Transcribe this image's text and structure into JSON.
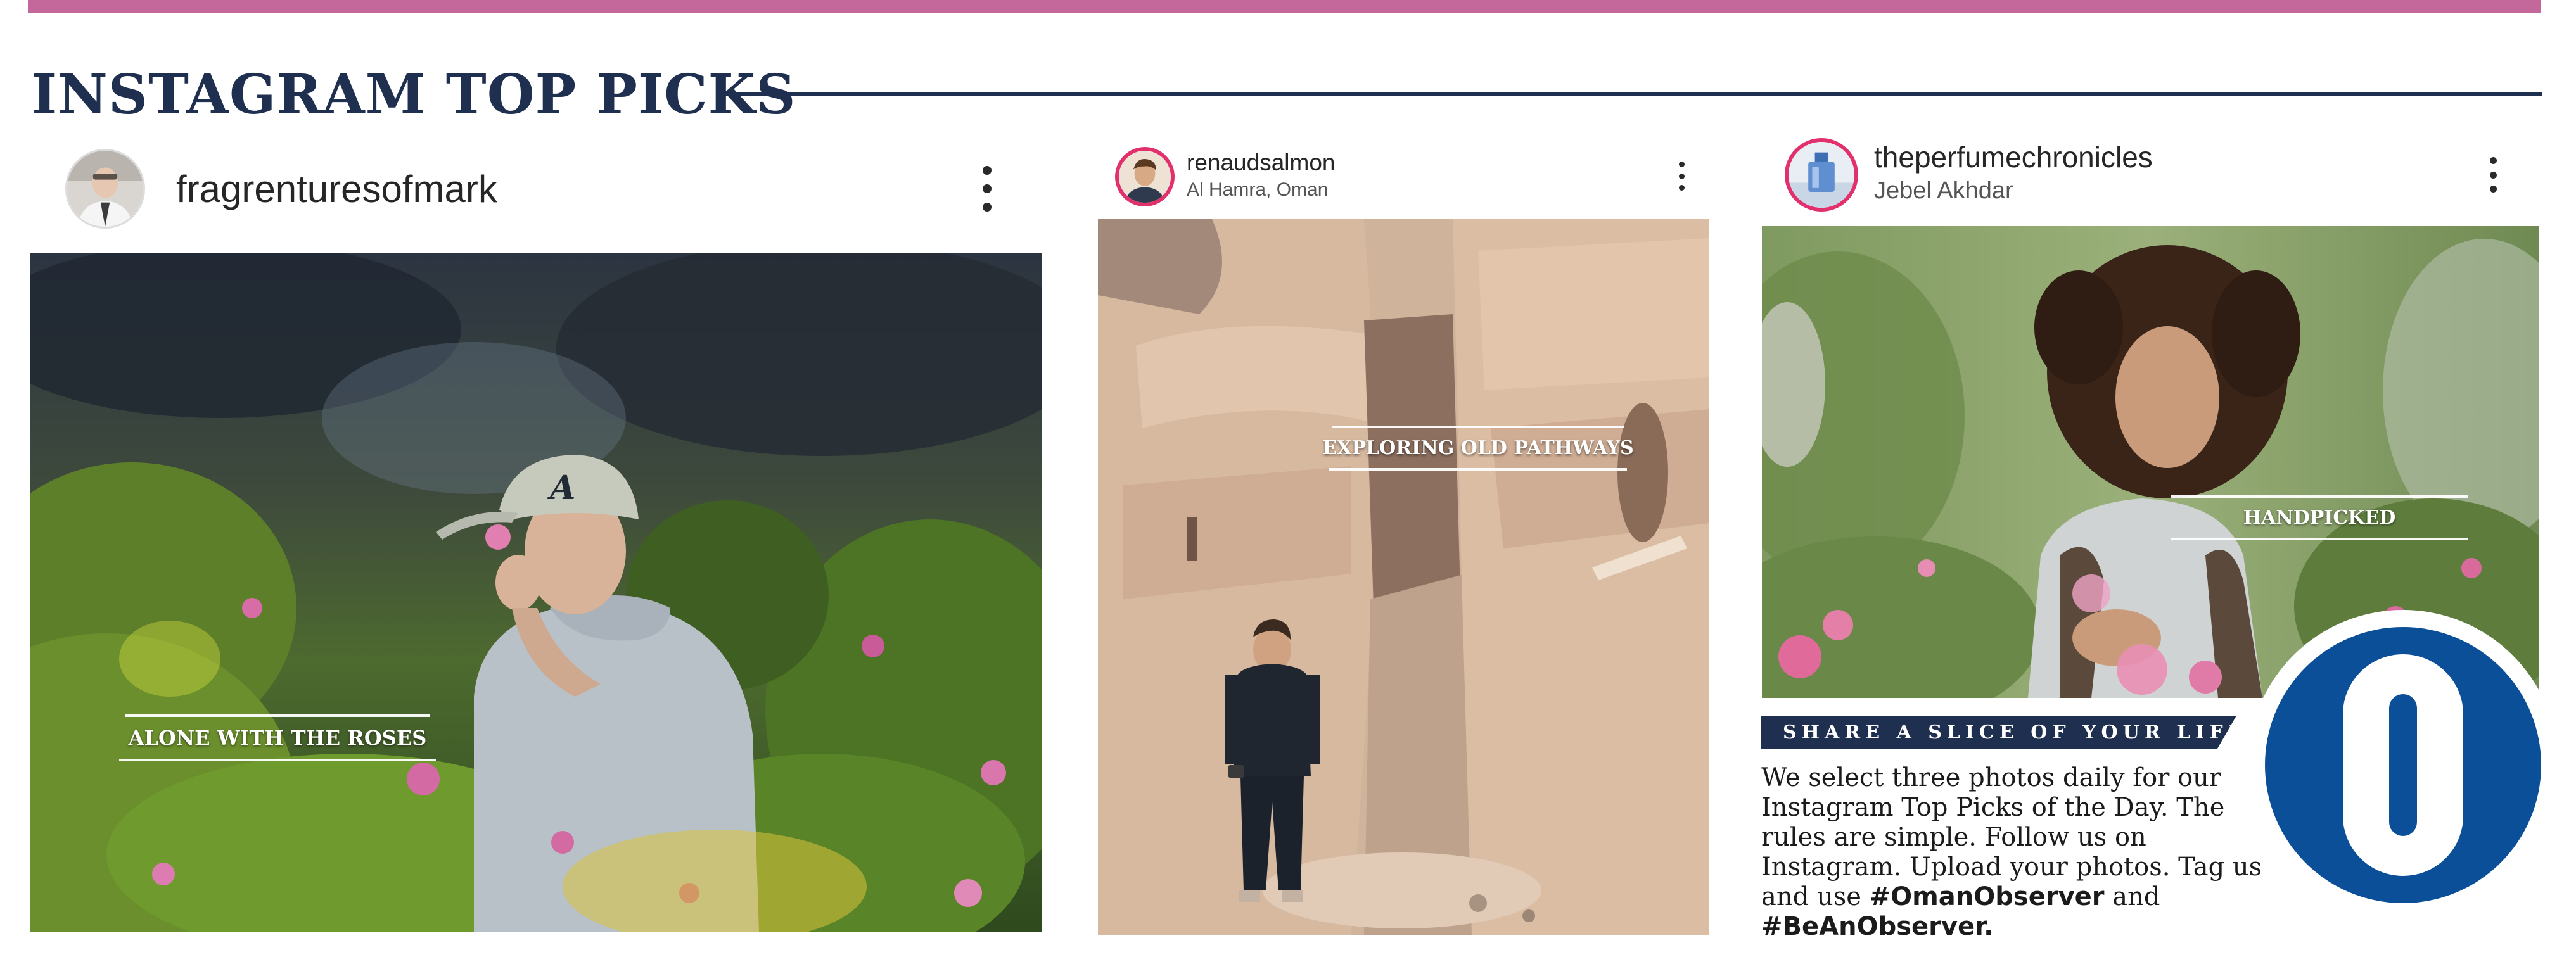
{
  "header": {
    "title": "INSTAGRAM TOP PICKS"
  },
  "colors": {
    "accent_bar": "#c4679b",
    "navy": "#1e2f4f",
    "logo_blue": "#0b4f99",
    "instagram_ring": "#e1306c"
  },
  "posts": [
    {
      "username": "fragrenturesofmark",
      "location": "",
      "avatar_icon": "person-avatar",
      "menu_icon": "more-vertical-icon",
      "caption": "ALONE WITH THE ROSES"
    },
    {
      "username": "renaudsalmon",
      "location": "Al Hamra, Oman",
      "avatar_icon": "person-avatar",
      "menu_icon": "more-vertical-icon",
      "caption": "EXPLORING OLD PATHWAYS"
    },
    {
      "username": "theperfumechronicles",
      "location": "Jebel Akhdar",
      "avatar_icon": "perfume-bottle-avatar",
      "menu_icon": "more-vertical-icon",
      "caption": "HANDPICKED"
    }
  ],
  "info": {
    "banner": "SHARE A SLICE OF YOUR LIFE",
    "body": "We select three photos daily for our Instagram Top Picks of the Day. The rules are simple. Follow us on Instagram. Upload your photos. Tag us and use",
    "hashtag1": "#OmanObserver",
    "connector": "and",
    "hashtag2": "#BeAnObserver."
  },
  "logo": {
    "icon": "oman-observer-o-logo"
  }
}
